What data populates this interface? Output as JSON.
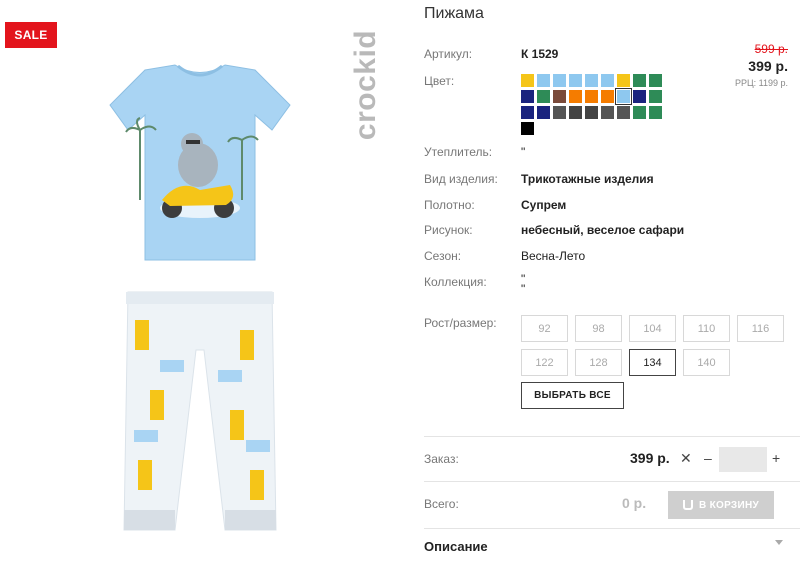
{
  "product": {
    "title": "Пижама",
    "sale_badge": "SALE",
    "brand": "crockid"
  },
  "price": {
    "old": "599 р.",
    "current": "399 р.",
    "rrp": "РРЦ: 1199 р."
  },
  "details": {
    "article_label": "Артикул:",
    "article_value": "К 1529",
    "color_label": "Цвет:",
    "insulation_label": "Утеплитель:",
    "insulation_value": "\"",
    "type_label": "Вид изделия:",
    "type_value": "Трикотажные изделия",
    "fabric_label": "Полотно:",
    "fabric_value": "Супрем",
    "pattern_label": "Рисунок:",
    "pattern_value": "небесный, веселое сафари",
    "season_label": "Сезон:",
    "season_value": "Весна-Лето",
    "collection_label": "Коллекция:",
    "collection_value_1": "\"",
    "collection_value_2": "\"",
    "size_label": "Рост/размер:"
  },
  "swatch_colors": [
    [
      "#f5c518",
      "#8ec8ef",
      "#8ec8ef",
      "#8ec8ef",
      "#8ec8ef",
      "#8ec8ef",
      "#f5c518",
      "#2e8b57",
      "#2e8b57"
    ],
    [
      "#1a237e",
      "#2e8b57",
      "#7a4a3a",
      "#f57c00",
      "#f57c00",
      "#f57c00",
      "#8ec8ef",
      "#1a237e",
      "#2e8b57"
    ],
    [
      "#1a237e",
      "#1a237e",
      "#555555",
      "#444444",
      "#444444",
      "#555555",
      "#555555",
      "#2e8b57",
      "#2e8b57"
    ],
    [
      "#000000"
    ]
  ],
  "selected_swatch": "1-6",
  "sizes": {
    "row1": [
      "92",
      "98",
      "104",
      "110",
      "116"
    ],
    "row2": [
      "122",
      "128",
      "134",
      "140"
    ],
    "active": "134",
    "select_all": "ВЫБРАТЬ ВСЕ"
  },
  "order": {
    "label": "Заказ:",
    "price": "399 р.",
    "times": "✕",
    "minus": "–",
    "plus": "+",
    "quantity": ""
  },
  "total": {
    "label": "Всего:",
    "value": "0 р.",
    "cart_button": "В КОРЗИНУ"
  },
  "description": {
    "label": "Описание"
  }
}
